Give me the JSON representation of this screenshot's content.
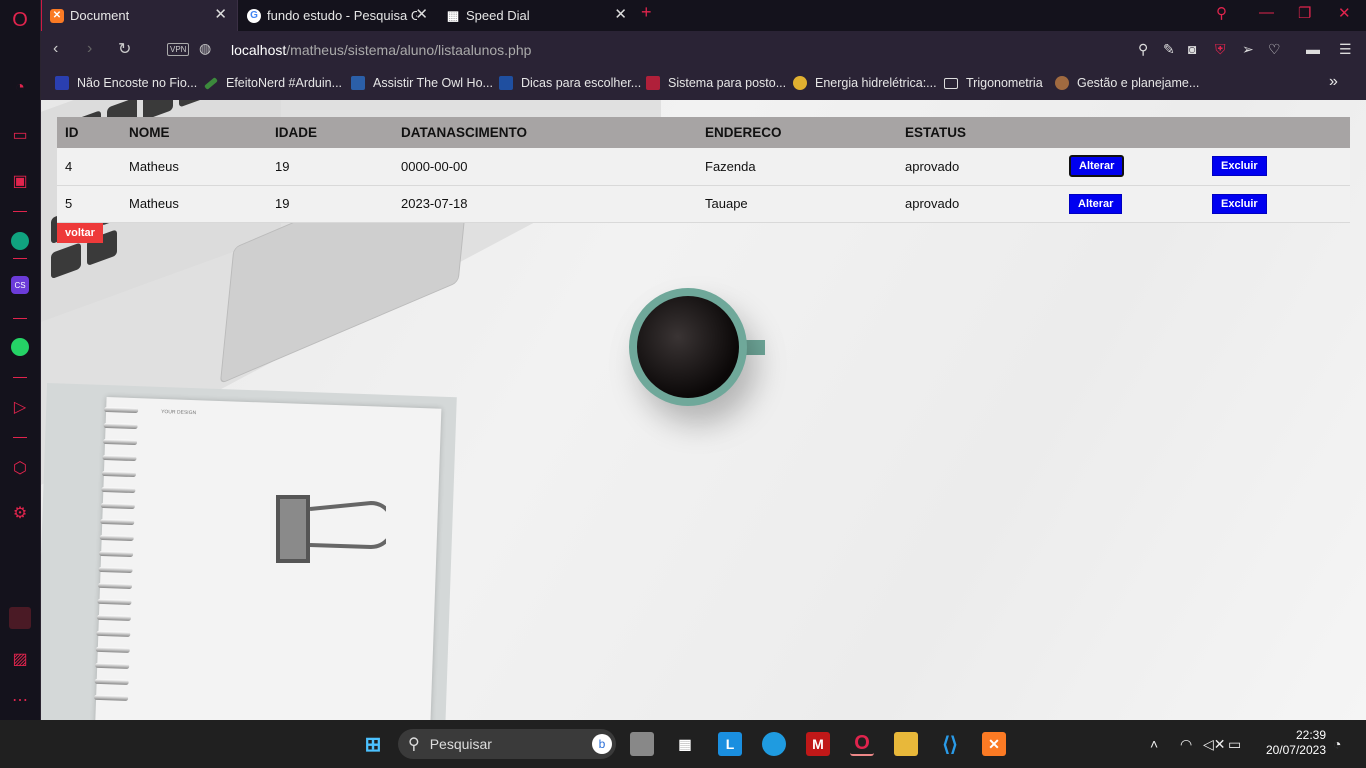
{
  "browser": {
    "tabs": [
      {
        "label": "Document",
        "active": true
      },
      {
        "label": "fundo estudo - Pesquisa Go",
        "active": false
      },
      {
        "label": "Speed Dial",
        "active": false
      }
    ],
    "new_tab": "+",
    "vpn_label": "VPN",
    "url_host": "localhost",
    "url_path": "/matheus/sistema/aluno/listaalunos.php",
    "bookmarks": [
      "Não Encoste no Fio...",
      "EfeitoNerd #Arduin...",
      "Assistir The Owl Ho...",
      "Dicas para escolher...",
      "Sistema para posto...",
      "Energia hidrelétrica:...",
      "Trigonometria",
      "Gestão e planejame..."
    ],
    "bookmarks_more": "»"
  },
  "table": {
    "headers": [
      "ID",
      "NOME",
      "IDADE",
      "DATANASCIMENTO",
      "ENDERECO",
      "ESTATUS",
      "",
      ""
    ],
    "rows": [
      {
        "id": "4",
        "nome": "Matheus",
        "idade": "19",
        "nascimento": "0000-00-00",
        "endereco": "Fazenda",
        "status": "aprovado",
        "alterar": "Alterar",
        "excluir": "Excluir"
      },
      {
        "id": "5",
        "nome": "Matheus",
        "idade": "19",
        "nascimento": "2023-07-18",
        "endereco": "Tauape",
        "status": "aprovado",
        "alterar": "Alterar",
        "excluir": "Excluir"
      }
    ]
  },
  "voltar_label": "voltar",
  "notebook_label": "YOUR DESIGN",
  "taskbar": {
    "search_placeholder": "Pesquisar",
    "time": "22:39",
    "date": "20/07/2023"
  },
  "colors": {
    "accent": "#e0244d",
    "button_blue": "#0000f0",
    "voltar_red": "#ee3a3a",
    "table_header": "#a7a4a4"
  }
}
